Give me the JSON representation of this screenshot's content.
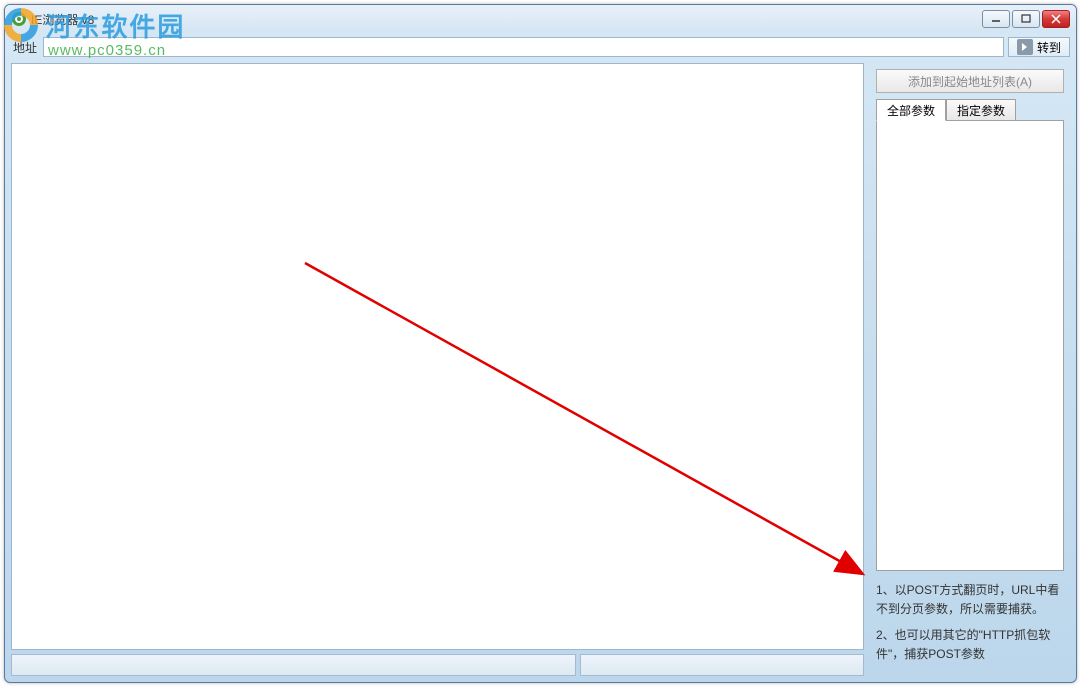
{
  "window": {
    "title": "IE浏览器 v8"
  },
  "addressbar": {
    "label": "地址",
    "value": "",
    "go_label": "转到"
  },
  "sidepanel": {
    "add_button": "添加到起始地址列表(A)",
    "tabs": [
      {
        "label": "全部参数",
        "active": true
      },
      {
        "label": "指定参数",
        "active": false
      }
    ],
    "hints": [
      "1、以POST方式翻页时，URL中看不到分页参数，所以需要捕获。",
      "2、也可以用其它的\"HTTP抓包软件\"，捕获POST参数"
    ]
  },
  "watermark": {
    "text": "河东软件园",
    "url": "www.pc0359.cn"
  }
}
